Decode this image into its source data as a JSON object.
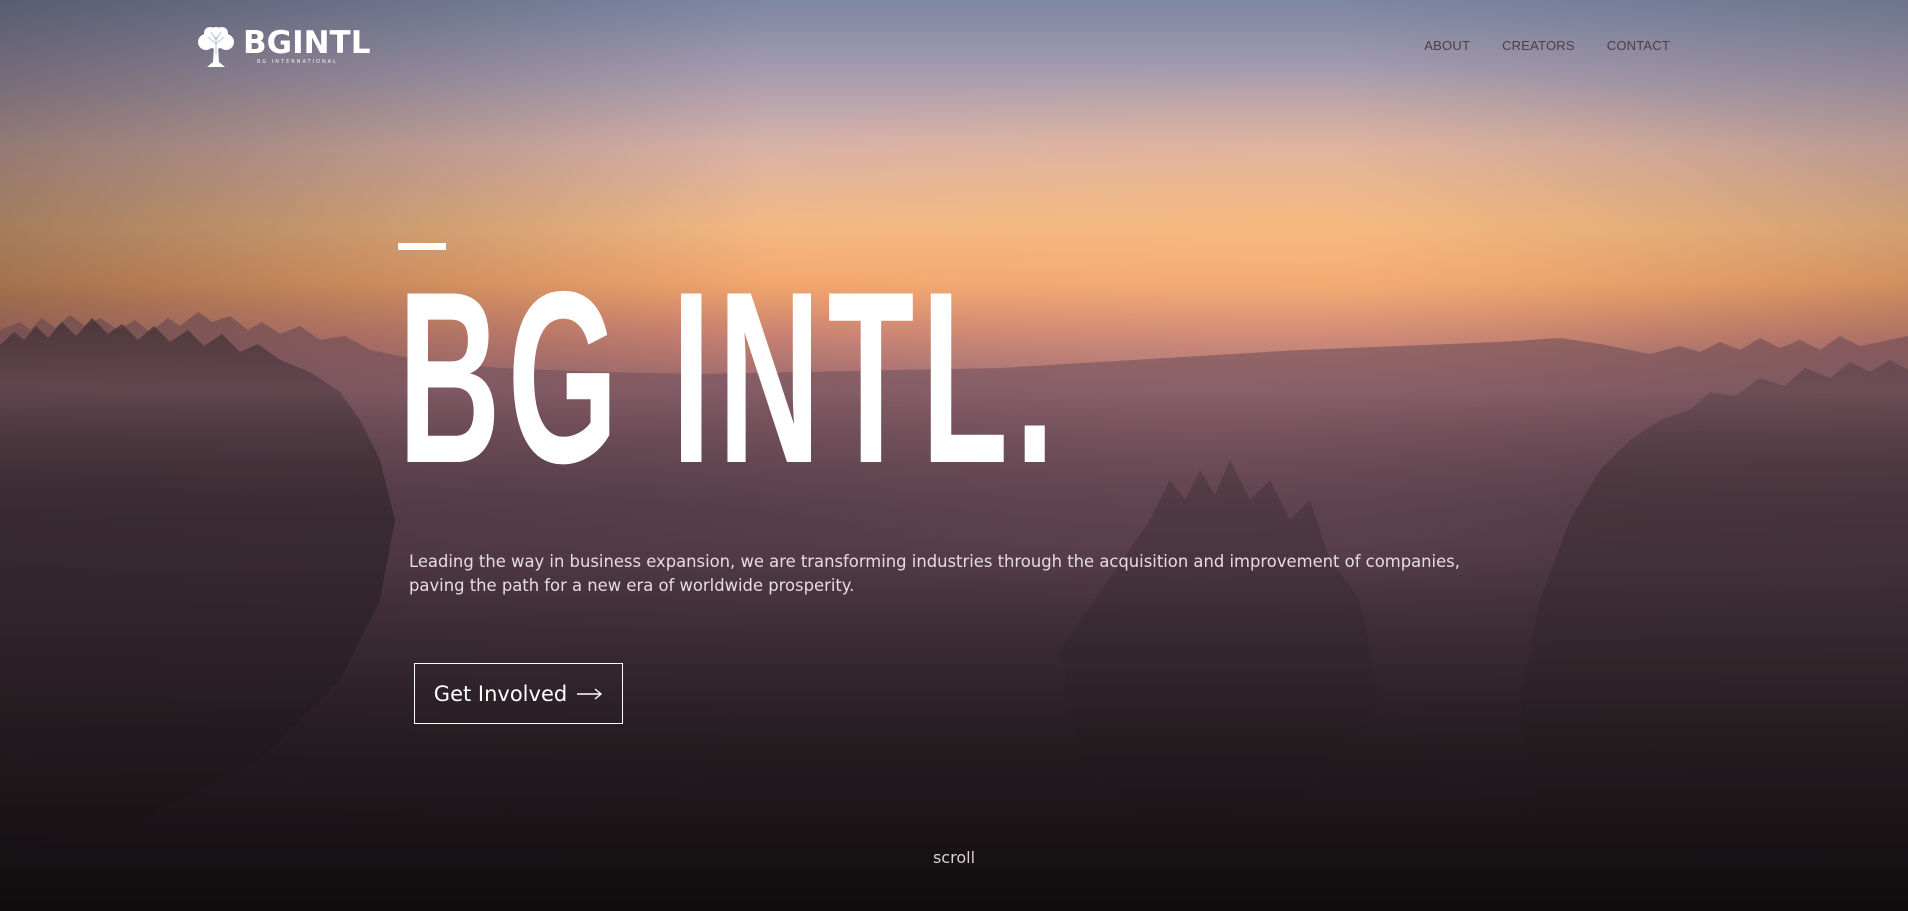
{
  "header": {
    "logo": {
      "wordmark": "BGINTL",
      "tagline": "BG INTERNATIONAL",
      "icon": "tree-icon"
    },
    "nav": [
      {
        "label": "ABOUT"
      },
      {
        "label": "CREATORS"
      },
      {
        "label": "CONTACT"
      }
    ]
  },
  "hero": {
    "title": "BG INTL.",
    "description": "Leading the way in business expansion, we are transforming industries through the acquisition and improvement of companies, paving the path for a new era of worldwide prosperity.",
    "cta": {
      "label": "Get Involved",
      "icon": "arrow-right-icon"
    },
    "scroll_label": "scroll",
    "background": "misty forest at sunset"
  },
  "colors": {
    "accent": "#ffffff",
    "nav_text": "#4a3f44",
    "sky_top": "#7c86a3",
    "sky_glow": "#f3a66d",
    "ground": "#151113"
  }
}
